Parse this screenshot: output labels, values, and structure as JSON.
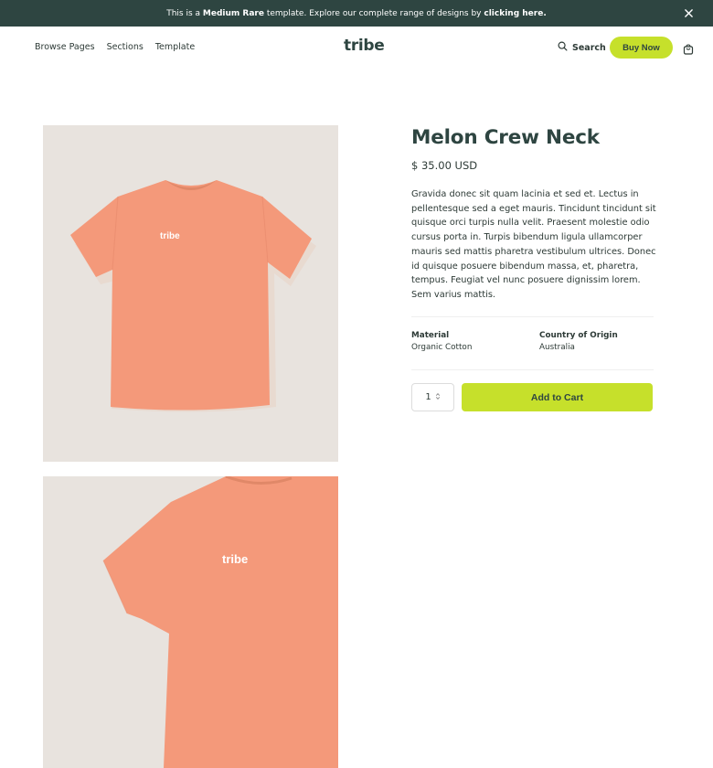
{
  "banner": {
    "text_before": "This is a ",
    "strong_1": "Medium Rare",
    "text_middle": " template. Explore our complete range of designs by ",
    "strong_2": "clicking here.",
    "close_icon": "close-icon"
  },
  "nav": {
    "links": [
      "Browse Pages",
      "Sections",
      "Template"
    ],
    "logo": "tribe",
    "search_label": "Search",
    "buy_label": "Buy Now",
    "icons": {
      "search": "search-icon",
      "cart": "shopping-bag-icon"
    }
  },
  "product": {
    "title": "Melon Crew Neck",
    "price": "$ 35.00 USD",
    "description": "Gravida donec sit quam lacinia et sed et. Lectus in pellentesque sed a eget mauris. Tincidunt tincidunt sit quisque orci turpis nulla velit. Praesent molestie odio cursus porta in. Turpis bibendum ligula ullamcorper mauris sed mattis pharetra vestibulum ultrices. Donec id quisque posuere bibendum massa, et, pharetra, tempus. Feugiat vel nunc posuere dignissim lorem. Sem varius mattis.",
    "specs": [
      {
        "label": "Material",
        "value": "Organic Cotton"
      },
      {
        "label": "Country of Origin",
        "value": "Australia"
      }
    ],
    "quantity": "1",
    "add_to_cart": "Add to Cart",
    "shirt_print": "tribe"
  },
  "colors": {
    "banner_bg": "#2e4541",
    "accent": "#c6e02b",
    "shirt": "#f4997a",
    "image_bg": "#e8e3de"
  }
}
